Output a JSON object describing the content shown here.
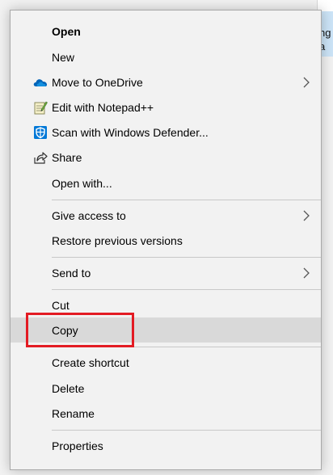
{
  "background": {
    "line1": "ng",
    "line2": "a"
  },
  "menu": {
    "items": [
      {
        "label": "Open",
        "bold": true
      },
      {
        "label": "New"
      },
      {
        "label": "Move to OneDrive",
        "icon": "onedrive-cloud-icon",
        "submenu": true
      },
      {
        "label": "Edit with Notepad++",
        "icon": "notepadpp-icon"
      },
      {
        "label": "Scan with Windows Defender...",
        "icon": "windows-defender-icon"
      },
      {
        "label": "Share",
        "icon": "share-icon"
      },
      {
        "label": "Open with..."
      },
      {
        "label": "Give access to",
        "submenu": true
      },
      {
        "label": "Restore previous versions"
      },
      {
        "label": "Send to",
        "submenu": true
      },
      {
        "label": "Cut"
      },
      {
        "label": "Copy",
        "hovered": true,
        "annotated": true
      },
      {
        "label": "Create shortcut"
      },
      {
        "label": "Delete"
      },
      {
        "label": "Rename"
      },
      {
        "label": "Properties"
      }
    ]
  },
  "colors": {
    "menu_bg": "#f2f2f2",
    "hover_bg": "#d9d9d9",
    "separator": "#c8c8c8",
    "annotation_red": "#e31b23",
    "onedrive_blue": "#0364b8",
    "defender_blue": "#0078d7"
  }
}
